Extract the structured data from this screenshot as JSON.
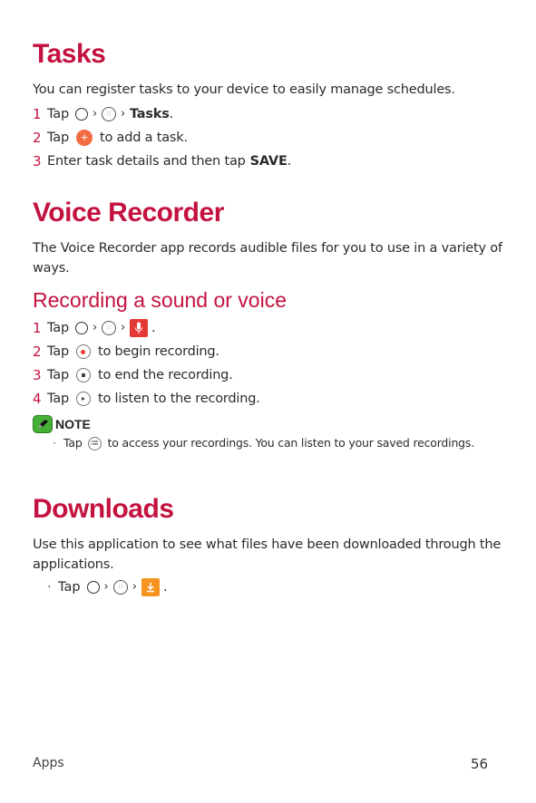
{
  "tasks": {
    "title": "Tasks",
    "intro": "You can register tasks to your device to easily manage schedules.",
    "steps": [
      {
        "num": "1",
        "tap": "Tap",
        "target": "Tasks",
        "end": "."
      },
      {
        "num": "2",
        "tap": "Tap",
        "text": "to add a task."
      },
      {
        "num": "3",
        "text": "Enter task details and then tap",
        "bold": "SAVE",
        "end": "."
      }
    ]
  },
  "voice_recorder": {
    "title": "Voice Recorder",
    "intro": "The Voice Recorder app records audible files for you to use in a variety of ways.",
    "subtitle": "Recording a sound or voice",
    "steps": [
      {
        "num": "1",
        "tap": "Tap",
        "end": "."
      },
      {
        "num": "2",
        "tap": "Tap",
        "text": "to begin recording."
      },
      {
        "num": "3",
        "tap": "Tap",
        "text": "to end the recording."
      },
      {
        "num": "4",
        "tap": "Tap",
        "text": "to listen to the recording."
      }
    ],
    "note": {
      "label": "NOTE",
      "tap": "Tap",
      "text": "to access your recordings. You can listen to your saved recordings."
    }
  },
  "downloads": {
    "title": "Downloads",
    "intro": "Use this application to see what files have been downloaded through the applications.",
    "tap": "Tap",
    "end": "."
  },
  "icons": {
    "chevron": "›",
    "apps_dots": "∷",
    "plus": "+"
  },
  "footer": {
    "section": "Apps",
    "page": "56"
  },
  "colors": {
    "heading": "#c3123f",
    "plus_button": "#f06b42",
    "mic_icon": "#e53935",
    "download_icon": "#f7931e",
    "note_badge": "#45b035"
  }
}
